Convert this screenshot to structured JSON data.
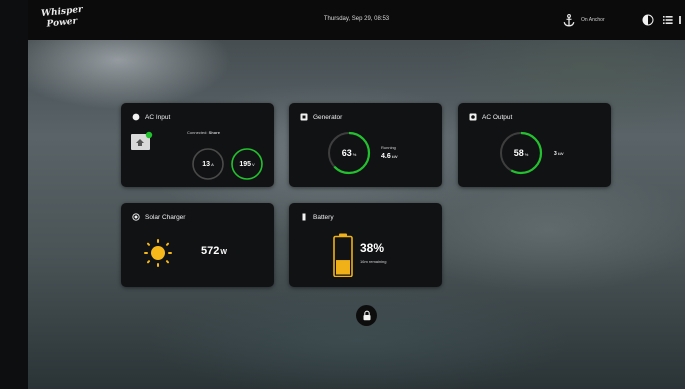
{
  "app": {
    "logo_line1": "Whisper",
    "logo_line2": "Power",
    "date": "Thursday, Sep 29, 08:53",
    "anchor_status": "On Anchor",
    "icons": {
      "anchor": "anchor-icon",
      "theme": "half-circle-icon",
      "menu": "list-icon",
      "lock": "lock-icon"
    }
  },
  "ac_input": {
    "title": "AC Input",
    "connected_label": "Connected:",
    "connected_value": "Shore",
    "value1": "13",
    "value1_unit": "A",
    "value2": "195",
    "value2_unit": "V"
  },
  "generator": {
    "title": "Generator",
    "percent": "63",
    "percent_unit": "%",
    "status": "Running",
    "power": "4.6",
    "power_unit": "kW",
    "level": 0.63
  },
  "ac_output": {
    "title": "AC Output",
    "percent": "58",
    "percent_unit": "%",
    "power": "3",
    "power_unit": "kW",
    "level": 0.58
  },
  "solar": {
    "title": "Solar Charger",
    "power": "572",
    "power_unit": "W"
  },
  "battery": {
    "title": "Battery",
    "percent": "38%",
    "remaining": "16m remaining",
    "level": 0.38
  },
  "colors": {
    "accent_green": "#22c22e",
    "battery_yellow": "#f0b017",
    "sun_yellow": "#f6b81a"
  }
}
